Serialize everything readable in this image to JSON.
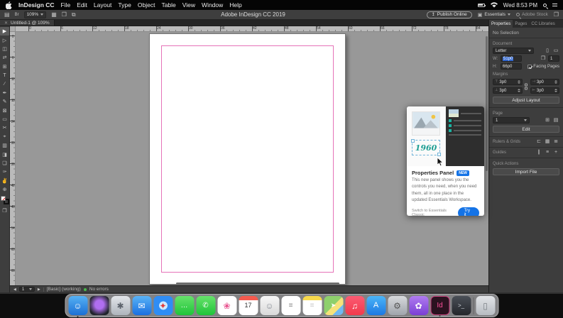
{
  "colors": {
    "adobe_blue": "#1473e6",
    "selection_blue": "#3166cd",
    "margin_guide_pink": "#e673b8",
    "preflight_green": "#49b84c"
  },
  "menu_bar": {
    "items": [
      {
        "label": "InDesign CC",
        "bold": true
      },
      {
        "label": "File"
      },
      {
        "label": "Edit"
      },
      {
        "label": "Layout"
      },
      {
        "label": "Type"
      },
      {
        "label": "Object"
      },
      {
        "label": "Table"
      },
      {
        "label": "View"
      },
      {
        "label": "Window"
      },
      {
        "label": "Help"
      }
    ],
    "clock": "Wed 8:53 PM"
  },
  "app_header": {
    "zoom_level": "109%",
    "title": "Adobe InDesign CC 2019",
    "publish_button": "Publish Online",
    "workspace": "Essentials",
    "stock_search": "Adobe Stock"
  },
  "doc_tab": {
    "label": "Untitled-1 @ 109%",
    "close_glyph": "✕"
  },
  "rulers": {
    "horizontal": [
      "0",
      "6",
      "12",
      "18",
      "24",
      "30",
      "36",
      "42",
      "48",
      "54",
      "60",
      "66",
      "72",
      "78",
      "84"
    ],
    "vertical": [
      "0",
      "6",
      "12",
      "18",
      "24",
      "30",
      "36",
      "42",
      "48",
      "54",
      "60",
      "66"
    ]
  },
  "tool_panel": {
    "tools": [
      {
        "name": "selection-tool",
        "glyph": "▶",
        "active": true
      },
      {
        "name": "direct-selection-tool",
        "glyph": "▷"
      },
      {
        "name": "page-tool",
        "glyph": "◫"
      },
      {
        "name": "gap-tool",
        "glyph": "⇄"
      },
      {
        "name": "content-collector-tool",
        "glyph": "⊞"
      },
      {
        "name": "type-tool",
        "glyph": "T"
      },
      {
        "name": "line-tool",
        "glyph": "∕"
      },
      {
        "name": "pen-tool",
        "glyph": "✒"
      },
      {
        "name": "pencil-tool",
        "glyph": "✎"
      },
      {
        "name": "rectangle-frame-tool",
        "glyph": "⊠"
      },
      {
        "name": "rectangle-tool",
        "glyph": "▭"
      },
      {
        "name": "scissors-tool",
        "glyph": "✂"
      },
      {
        "name": "free-transform-tool",
        "glyph": "⌖"
      },
      {
        "name": "gradient-swatch-tool",
        "glyph": "▥"
      },
      {
        "name": "gradient-feather-tool",
        "glyph": "◨"
      },
      {
        "name": "note-tool",
        "glyph": "❏"
      },
      {
        "name": "eyedropper-tool",
        "glyph": "✑"
      },
      {
        "name": "hand-tool",
        "glyph": "✌"
      },
      {
        "name": "zoom-tool",
        "glyph": "⊕"
      }
    ]
  },
  "properties_panel": {
    "tabs": [
      {
        "name": "tab-properties",
        "label": "Properties",
        "active": true
      },
      {
        "name": "tab-pages",
        "label": "Pages"
      },
      {
        "name": "tab-cc-libraries",
        "label": "CC Libraries"
      }
    ],
    "selection_status": "No Selection",
    "document": {
      "section_label": "Document",
      "page_size": "Letter",
      "width_label": "W:",
      "width_value": "51p0",
      "height_label": "H:",
      "height_value": "66p0",
      "pages_value": "1",
      "facing_pages_label": "Facing Pages"
    },
    "margins": {
      "section_label": "Margins",
      "top": "3p0",
      "bottom": "3p0",
      "left": "3p0",
      "right": "3p0"
    },
    "adjust_layout_button": "Adjust Layout",
    "page": {
      "section_label": "Page",
      "current": "1",
      "edit_button": "Edit"
    },
    "rulers_grids_label": "Rulers & Grids",
    "guides_label": "Guides",
    "quick_actions": {
      "section_label": "Quick Actions",
      "import_button": "Import File"
    }
  },
  "popup": {
    "title": "Properties Panel",
    "badge": "NEW",
    "body": "This new panel shows you the controls you need, when you need them, all in one place in the updated Essentials Workspace.",
    "link": "Switch to Essentials Classic",
    "button": "Try it",
    "illustration_year": "1960"
  },
  "status_bar": {
    "page": "1",
    "preset": "[Basic] (working)",
    "errors_label": "No errors"
  },
  "dock": {
    "items": [
      {
        "name": "dock-finder",
        "glyph": "☺",
        "bg": "linear-gradient(180deg,#55b1f4,#1c6fd4)",
        "fg": "#fff",
        "open": true
      },
      {
        "name": "dock-siri",
        "glyph": "",
        "bg": "radial-gradient(circle at 50% 45%, #b06ef0 0 30%, #21242b 75%)"
      },
      {
        "name": "dock-launchpad",
        "glyph": "✱",
        "bg": "linear-gradient(180deg,#e3e6ea,#aeb4bc)",
        "fg": "#5b626b"
      },
      {
        "name": "dock-mail",
        "glyph": "✉",
        "bg": "linear-gradient(180deg,#59b3f6,#1a6fe0)",
        "fg": "#fff"
      },
      {
        "name": "dock-safari",
        "glyph": "✦",
        "bg": "radial-gradient(circle,#cfe8ff 0 30%,#2f8df5 32%)",
        "fg": "#e23c3c"
      },
      {
        "name": "dock-messages",
        "glyph": "…",
        "bg": "linear-gradient(180deg,#67e26b,#1fc439)",
        "fg": "#fff",
        "size": "10px"
      },
      {
        "name": "dock-facetime",
        "glyph": "✆",
        "bg": "linear-gradient(180deg,#67e26b,#1fc439)",
        "fg": "#fff",
        "size": "10px"
      },
      {
        "name": "dock-photos",
        "glyph": "❀",
        "bg": "#ffffff",
        "fg": "#e8538f"
      },
      {
        "name": "dock-calendar",
        "glyph": "17",
        "bg": "linear-gradient(180deg,#f55a4e 0 22%,#ffffff 22%)",
        "fg": "#333",
        "size": "9px"
      },
      {
        "name": "dock-contacts",
        "glyph": "☺",
        "bg": "linear-gradient(180deg,#f7f7f7,#d9d9d9)",
        "fg": "#8a8f98"
      },
      {
        "name": "dock-reminders",
        "glyph": "≡",
        "bg": "#ffffff",
        "fg": "#888",
        "size": "10px"
      },
      {
        "name": "dock-notes",
        "glyph": "≡",
        "bg": "linear-gradient(180deg,#f7d94c 0 22%,#fff 22%)",
        "fg": "#c9c9c9",
        "size": "10px"
      },
      {
        "name": "dock-maps",
        "glyph": "➤",
        "bg": "linear-gradient(135deg,#8ed06c 0 50%,#f6e27a 50% 72%,#6fb9f2 72%)",
        "fg": "#fff",
        "size": "9px"
      },
      {
        "name": "dock-music",
        "glyph": "♫",
        "bg": "linear-gradient(180deg,#fb5b73,#f23a4c)",
        "fg": "#fff"
      },
      {
        "name": "dock-app-store",
        "glyph": "A",
        "bg": "linear-gradient(180deg,#4bb5f8,#1d78e2)",
        "fg": "#fff",
        "size": "11px"
      },
      {
        "name": "dock-system-preferences",
        "glyph": "⚙",
        "bg": "linear-gradient(180deg,#d8dadd,#9fa4ab)",
        "fg": "#555"
      },
      {
        "name": "dock-flower-app",
        "glyph": "✿",
        "bg": "linear-gradient(180deg,#b07bf0,#7a3fd4)",
        "fg": "#fff"
      },
      {
        "name": "dock-indesign",
        "glyph": "Id",
        "bg": "#2b1220",
        "fg": "#ff4f9a",
        "size": "10px",
        "border": "1px solid rgba(255,79,154,.75)",
        "open": true
      },
      {
        "name": "dock-terminal",
        "glyph": ">_",
        "bg": "linear-gradient(180deg,#4a4f57,#23262b)",
        "fg": "#cfd3da",
        "size": "8px"
      },
      {
        "name": "dock-separator",
        "sep": true
      },
      {
        "name": "dock-trash",
        "glyph": "▯",
        "bg": "linear-gradient(180deg,#e3e5e8,#b7bcc2)",
        "fg": "#7a7f85"
      }
    ]
  },
  "glyphs": {
    "stack": "▤",
    "bridge": "Br",
    "view_options": "▦",
    "screen_mode": "❒",
    "arrange": "⧉",
    "publish": "↥",
    "workspace": "▣",
    "panel_toggle": "❐",
    "portrait": "▯",
    "landscape": "▭",
    "pages": "❐",
    "page_plus": "⊞",
    "page_menu": "▤",
    "ruler_icon": "⊏",
    "doc_grid_icon": "▦",
    "baseline_icon": "≣",
    "col_guide_icon": "∥",
    "row_guide_icon": "≡",
    "guide_plus_icon": "+",
    "m_top": "⊤",
    "m_bottom": "⊥",
    "m_left": "⊣",
    "m_right": "⊢",
    "nav_prev": "◀",
    "nav_next": "▶"
  }
}
